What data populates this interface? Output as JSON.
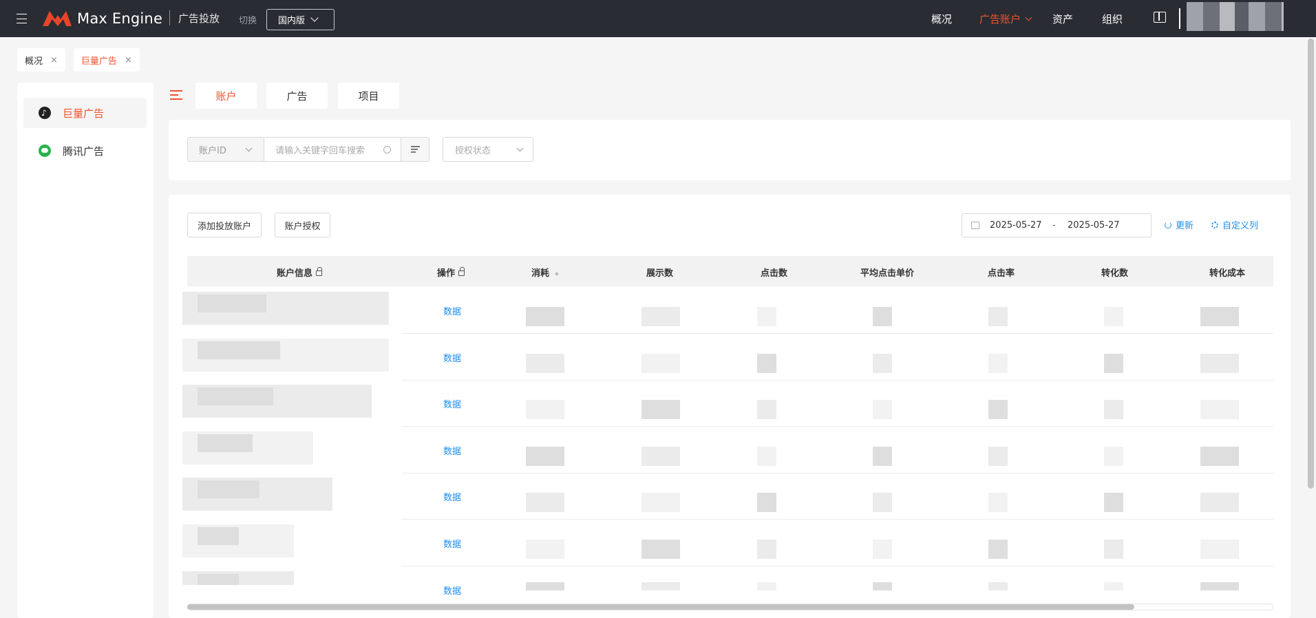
{
  "header": {
    "brand": "Max Engine",
    "product": "广告投放",
    "switch_label": "切换",
    "region": "国内版",
    "nav": [
      {
        "label": "概况",
        "active": false
      },
      {
        "label": "广告账户",
        "active": true
      },
      {
        "label": "资产",
        "active": false
      },
      {
        "label": "组织",
        "active": false
      }
    ],
    "brand_color": "#f2532e"
  },
  "open_tabs": [
    {
      "label": "概况",
      "active": false,
      "close": "×"
    },
    {
      "label": "巨量广告",
      "active": true,
      "close": "×"
    }
  ],
  "sidebar": {
    "items": [
      {
        "label": "巨量广告",
        "icon": "tiktok-icon",
        "active": true
      },
      {
        "label": "腾讯广告",
        "icon": "wechat-icon",
        "active": false
      }
    ]
  },
  "page_tabs": [
    {
      "label": "账户",
      "active": true
    },
    {
      "label": "广告",
      "active": false
    },
    {
      "label": "项目",
      "active": false
    }
  ],
  "filters": {
    "field_select": "账户ID",
    "search_placeholder": "请输入关键字回车搜索",
    "status_placeholder": "授权状态"
  },
  "toolbar": {
    "add_account": "添加投放账户",
    "authorize": "账户授权",
    "date_start": "2025-05-27",
    "date_sep": "-",
    "date_end": "2025-05-27",
    "refresh": "更新",
    "custom_columns": "自定义列"
  },
  "table": {
    "columns": [
      "账户信息",
      "操作",
      "消耗",
      "展示数",
      "点击数",
      "平均点击单价",
      "点击率",
      "转化数",
      "转化成本"
    ],
    "rows": [
      {
        "action": "数据"
      },
      {
        "action": "数据"
      },
      {
        "action": "数据"
      },
      {
        "action": "数据"
      },
      {
        "action": "数据"
      },
      {
        "action": "数据"
      },
      {
        "action": "数据"
      }
    ]
  }
}
